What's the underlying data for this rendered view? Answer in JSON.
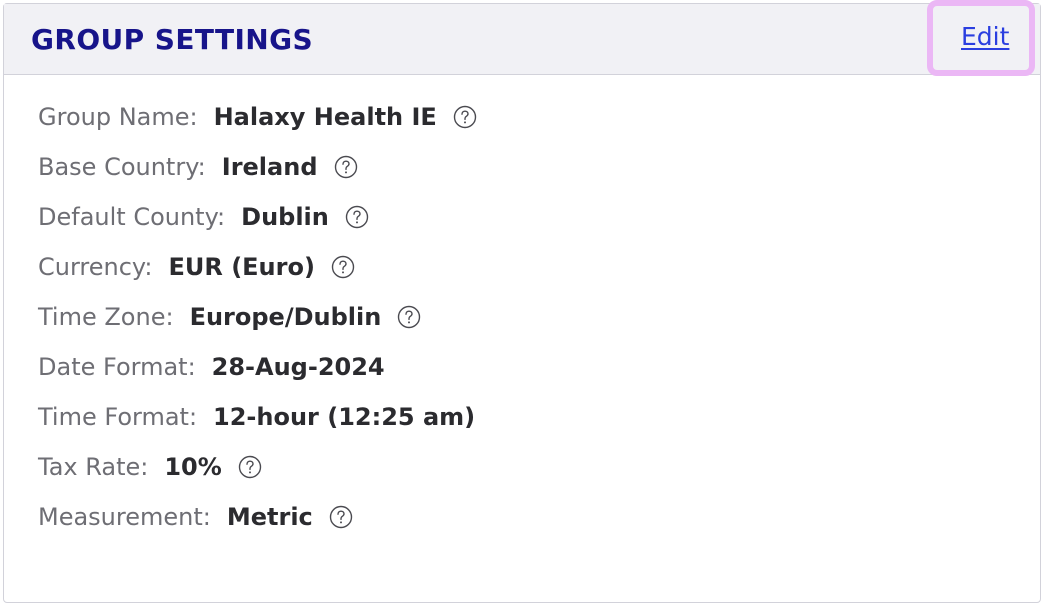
{
  "header": {
    "title": "GROUP SETTINGS",
    "edit_label": "Edit"
  },
  "settings": [
    {
      "label": "Group Name:",
      "value": "Halaxy Health IE",
      "help": true
    },
    {
      "label": "Base Country:",
      "value": "Ireland",
      "help": true
    },
    {
      "label": "Default County:",
      "value": "Dublin",
      "help": true
    },
    {
      "label": "Currency:",
      "value": "EUR (Euro)",
      "help": true
    },
    {
      "label": "Time Zone:",
      "value": "Europe/Dublin",
      "help": true
    },
    {
      "label": "Date Format:",
      "value": "28-Aug-2024",
      "help": false
    },
    {
      "label": "Time Format:",
      "value": "12-hour (12:25 am)",
      "help": false
    },
    {
      "label": "Tax Rate:",
      "value": "10%",
      "help": true
    },
    {
      "label": "Measurement:",
      "value": "Metric",
      "help": true
    }
  ],
  "colors": {
    "title": "#17148a",
    "link": "#2a3ee0",
    "highlight": "#ebb7f5",
    "header_bg": "#f1f1f5",
    "label": "#6e6e74",
    "value": "#2b2b2f"
  },
  "icons": {
    "help": "question-circle-icon"
  }
}
